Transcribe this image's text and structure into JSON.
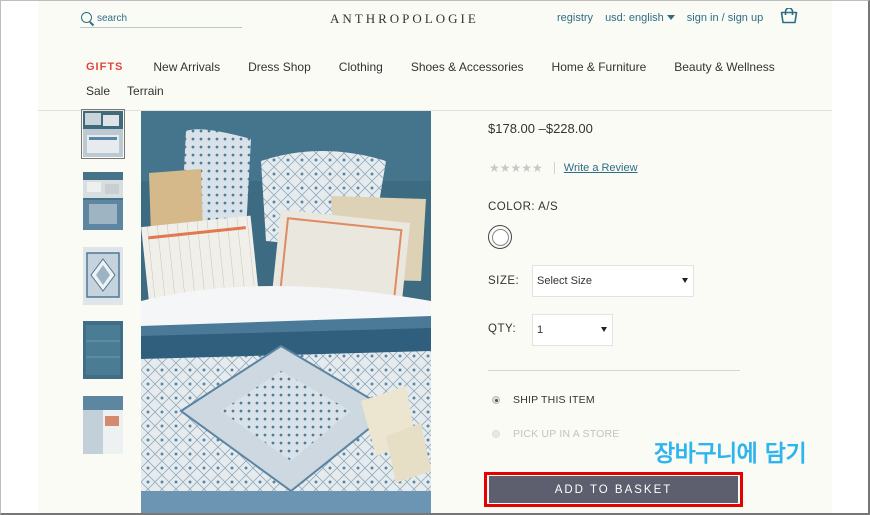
{
  "header": {
    "search_placeholder": "search",
    "logo": "ANTHROPOLOGIE",
    "registry": "registry",
    "locale": "usd: english",
    "sign_in": "sign in / sign up",
    "bag_icon": "shopping-bag-icon"
  },
  "nav": {
    "items": [
      "GIFTS",
      "New Arrivals",
      "Dress Shop",
      "Clothing",
      "Shoes & Accessories",
      "Home & Furniture",
      "Beauty & Wellness",
      "Sale",
      "Terrain"
    ]
  },
  "product": {
    "price": "$178.00 –$228.00",
    "stars": "★★★★★",
    "write_review": "Write a Review",
    "color_label": "COLOR:",
    "color_value": "A/S",
    "size_label": "SIZE:",
    "size_value": "Select Size",
    "qty_label": "QTY:",
    "qty_value": "1",
    "ship_option": "SHIP THIS ITEM",
    "pickup_option": "PICK UP IN A STORE",
    "add_to_basket": "ADD TO BASKET"
  },
  "annotation": "장바구니에 담기",
  "colors": {
    "accent": "#2d6e85",
    "gifts": "#e0463c",
    "button": "#5d5e6e",
    "highlight": "#e60000",
    "annotation": "#2fb4ee"
  }
}
